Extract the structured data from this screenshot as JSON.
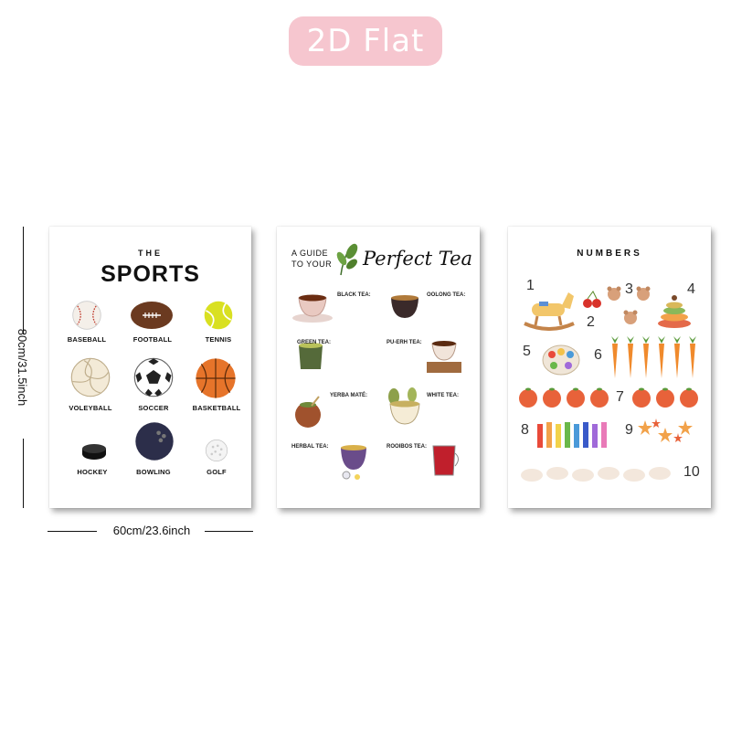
{
  "badge": {
    "label": "2D Flat"
  },
  "dimensions": {
    "height_label": "80cm/31.5inch",
    "width_label": "60cm/23.6inch"
  },
  "sports_poster": {
    "kicker": "THE",
    "title": "SPORTS",
    "items": [
      {
        "label": "BASEBALL",
        "icon": "baseball-icon"
      },
      {
        "label": "FOOTBALL",
        "icon": "football-icon"
      },
      {
        "label": "TENNIS",
        "icon": "tennis-ball-icon"
      },
      {
        "label": "VOLEYBALL",
        "icon": "volleyball-icon"
      },
      {
        "label": "SOCCER",
        "icon": "soccer-ball-icon"
      },
      {
        "label": "BASKETBALL",
        "icon": "basketball-icon"
      },
      {
        "label": "HOCKEY",
        "icon": "hockey-puck-icon"
      },
      {
        "label": "BOWLING",
        "icon": "bowling-ball-icon"
      },
      {
        "label": "GOLF",
        "icon": "golf-ball-icon"
      }
    ]
  },
  "tea_poster": {
    "guide_line1": "A GUIDE",
    "guide_line2": "TO YOUR",
    "title": "Perfect Tea",
    "teas": [
      {
        "name": "BLACK TEA:"
      },
      {
        "name": "OOLONG TEA:"
      },
      {
        "name": "GREEN TEA:"
      },
      {
        "name": "PU-ERH TEA:"
      },
      {
        "name": "YERBA MATÉ:"
      },
      {
        "name": "WHITE TEA:"
      },
      {
        "name": "HERBAL TEA:"
      },
      {
        "name": "ROOIBOS TEA:"
      }
    ]
  },
  "numbers_poster": {
    "title": "NUMBERS",
    "digits": [
      "1",
      "2",
      "3",
      "4",
      "5",
      "6",
      "7",
      "8",
      "9",
      "10"
    ]
  },
  "colors": {
    "badge_bg": "#f6c6cf",
    "carrot": "#f08a2c",
    "orange": "#e8623a"
  }
}
